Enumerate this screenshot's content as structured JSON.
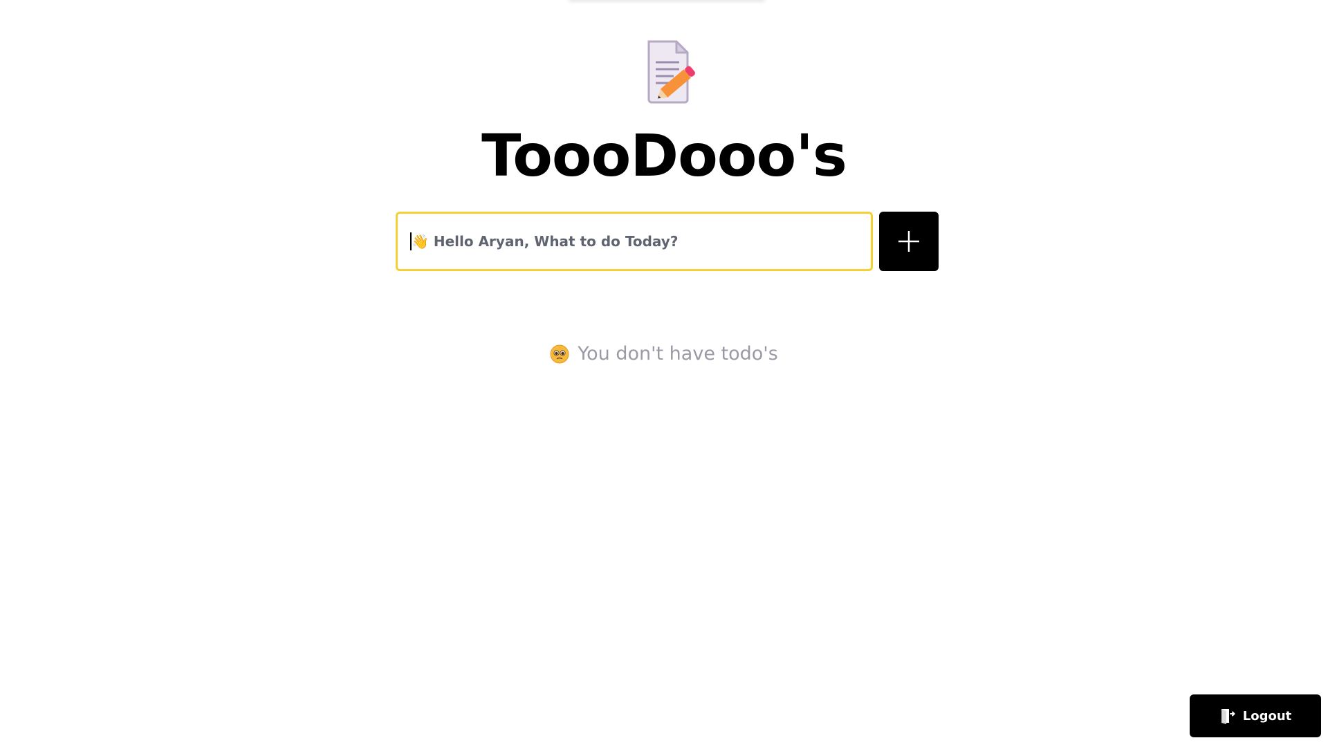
{
  "app": {
    "title": "ToooDooo's"
  },
  "input": {
    "placeholder": "👋 Hello Aryan, What to do Today?",
    "value": ""
  },
  "add_button": {
    "icon": "plus-icon"
  },
  "empty_state": {
    "icon": "pleading-face-icon",
    "text": "You don't have todo's"
  },
  "logout": {
    "label": "Logout",
    "icon": "logout-door-icon"
  },
  "colors": {
    "accent_border": "#f5d033",
    "button_bg": "#000000",
    "muted_text": "#9a9aa6"
  }
}
